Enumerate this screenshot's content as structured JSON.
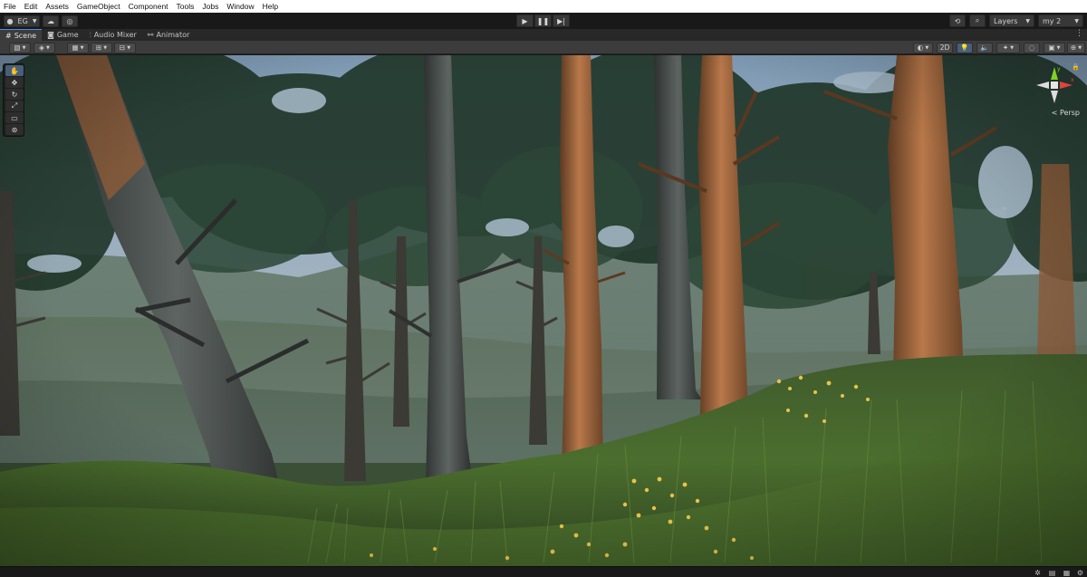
{
  "menu": [
    "File",
    "Edit",
    "Assets",
    "GameObject",
    "Component",
    "Tools",
    "Jobs",
    "Window",
    "Help"
  ],
  "toolbar": {
    "account_label": "EG",
    "layers_label": "Layers",
    "layout_label": "my 2"
  },
  "tabs": [
    {
      "label": "Scene",
      "icon": "grid-icon",
      "active": true
    },
    {
      "label": "Game",
      "icon": "gamepad-icon",
      "active": false
    },
    {
      "label": "Audio Mixer",
      "icon": "mixer-icon",
      "active": false
    },
    {
      "label": "Animator",
      "icon": "animator-icon",
      "active": false
    }
  ],
  "scene_toolbar": {
    "mode_2d_label": "2D"
  },
  "viewport": {
    "projection_label": "< Persp",
    "gizmo_axes": {
      "x": "x",
      "y": "y"
    }
  },
  "tools": [
    "hand-tool",
    "move-tool",
    "rotate-tool",
    "scale-tool",
    "rect-tool",
    "transform-tool"
  ],
  "colors": {
    "accent": "#4a90e2",
    "active_tool": "#46607c",
    "gizmo_x": "#e0453a",
    "gizmo_y": "#7ed321",
    "gizmo_z": "#4a90e2"
  }
}
